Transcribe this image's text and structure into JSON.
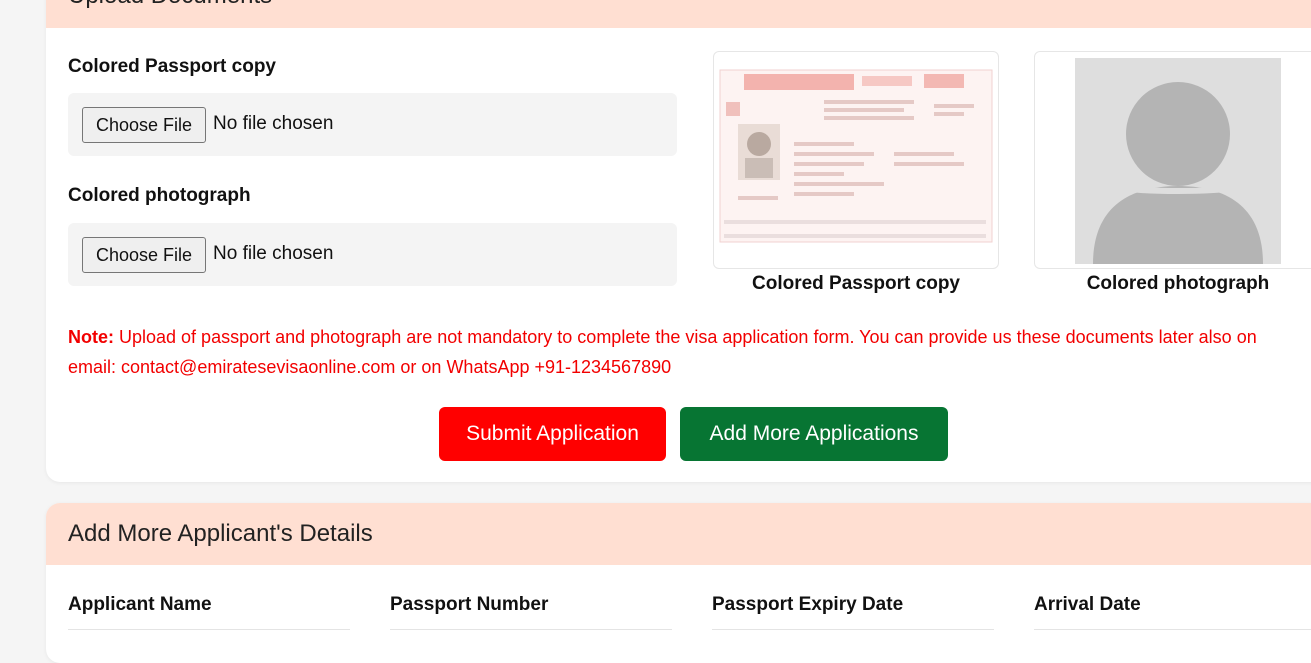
{
  "upload_section": {
    "title": "Upload Documents",
    "passport_label": "Colored Passport copy",
    "photo_label": "Colored photograph",
    "choose_file_label": "Choose File",
    "no_file_text": "No file chosen",
    "preview_passport_caption": "Colored Passport copy",
    "preview_photo_caption": "Colored photograph",
    "note_prefix": "Note:",
    "note_text": " Upload of passport and photograph are not mandatory to complete the visa application form. You can provide us these documents later also on email: contact@emiratesevisaonline.com or on WhatsApp +91-1234567890",
    "submit_label": "Submit Application",
    "add_more_label": "Add More Applications"
  },
  "applicants_section": {
    "title": "Add More Applicant's Details",
    "columns": [
      "Applicant Name",
      "Passport Number",
      "Passport Expiry Date",
      "Arrival Date"
    ]
  },
  "colors": {
    "header_bg": "#ffdfd2",
    "note_red": "#f20000",
    "submit_red": "#ff0000",
    "add_green": "#077533"
  }
}
